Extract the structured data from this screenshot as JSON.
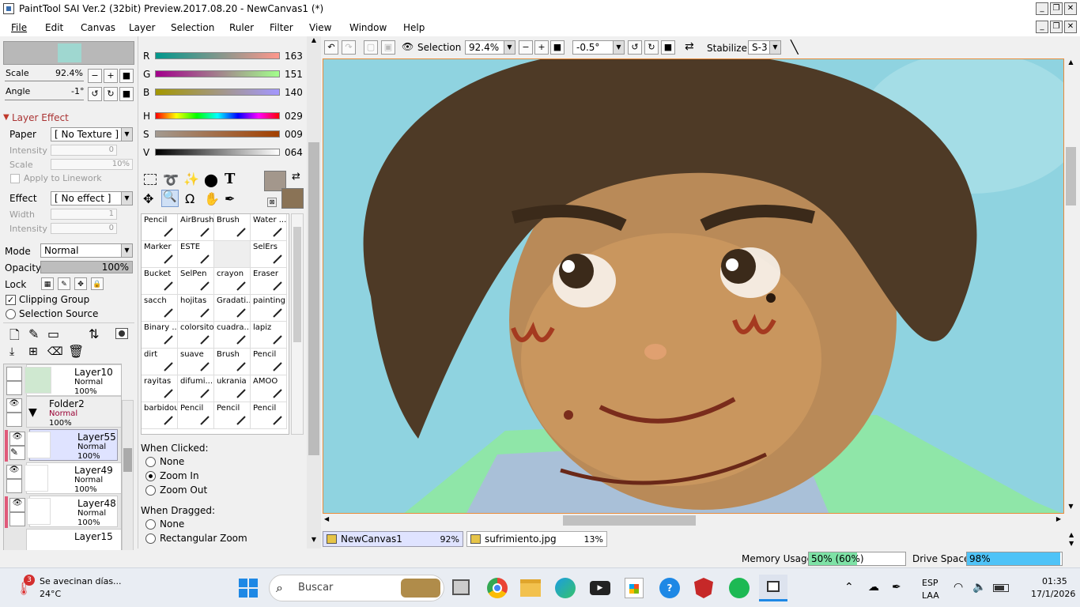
{
  "window": {
    "title": "PaintTool SAI Ver.2 (32bit) Preview.2017.08.20 - NewCanvas1 (*)"
  },
  "menu": [
    "File",
    "Edit",
    "Canvas",
    "Layer",
    "Selection",
    "Ruler",
    "Filter",
    "View",
    "Window",
    "Help"
  ],
  "nav": {
    "scale_label": "Scale",
    "scale_value": "92.4%",
    "angle_label": "Angle",
    "angle_value": "-1°"
  },
  "layer_effect": {
    "header": "Layer Effect",
    "paper_label": "Paper",
    "paper_value": "[ No Texture ]",
    "intensity_label": "Intensity",
    "intensity_value": "0",
    "scale_label": "Scale",
    "scale_value": "10%",
    "apply_linework": "Apply to Linework",
    "effect_label": "Effect",
    "effect_value": "[ No effect ]",
    "width_label": "Width",
    "width_value": "1",
    "intensity2_label": "Intensity",
    "intensity2_value": "0"
  },
  "layer_props": {
    "mode_label": "Mode",
    "mode_value": "Normal",
    "opacity_label": "Opacity",
    "opacity_value": "100%",
    "lock_label": "Lock",
    "clipping_group": "Clipping Group",
    "selection_source": "Selection Source"
  },
  "layers": [
    {
      "name": "Layer10",
      "mode": "Normal",
      "opacity": "100%"
    },
    {
      "name": "Folder2",
      "mode": "Normal",
      "opacity": "100%"
    },
    {
      "name": "Layer55",
      "mode": "Normal",
      "opacity": "100%"
    },
    {
      "name": "Layer49",
      "mode": "Normal",
      "opacity": "100%"
    },
    {
      "name": "Layer48",
      "mode": "Normal",
      "opacity": "100%"
    },
    {
      "name": "Layer15",
      "mode": "",
      "opacity": ""
    }
  ],
  "color": {
    "r_label": "R",
    "r_value": "163",
    "g_label": "G",
    "g_value": "151",
    "b_label": "B",
    "b_value": "140",
    "h_label": "H",
    "h_value": "029",
    "s_label": "S",
    "s_value": "009",
    "v_label": "V",
    "v_value": "064",
    "primary": "#a3978c",
    "secondary": "#8a7356"
  },
  "tools": [
    [
      "Pencil",
      "AirBrush",
      "Brush",
      "Water ..."
    ],
    [
      "Marker",
      "ESTE",
      "",
      "SelErs"
    ],
    [
      "Bucket",
      "SelPen",
      "crayon",
      "Eraser"
    ],
    [
      "sacch",
      "hojitas",
      "Gradati...",
      "painting"
    ],
    [
      "Binary ...",
      "colorsito",
      "cuadra...",
      "lapiz"
    ],
    [
      "dirt",
      "suave",
      "Brush",
      "Pencil"
    ],
    [
      "rayitas",
      "difumi...",
      "ukrania",
      "AMOO"
    ],
    [
      "barbidou",
      "Pencil",
      "Pencil",
      "Pencil"
    ]
  ],
  "zoom_options": {
    "when_clicked": "When Clicked:",
    "none": "None",
    "zoom_in": "Zoom In",
    "zoom_out": "Zoom Out",
    "when_dragged": "When Dragged:",
    "none2": "None",
    "rect_zoom": "Rectangular Zoom"
  },
  "toolbar": {
    "selection_label": "Selection",
    "zoom_value": "92.4%",
    "angle_value": "-0.5°",
    "stabilizer_label": "Stabilizer",
    "stabilizer_value": "S-3"
  },
  "tabs": [
    {
      "name": "NewCanvas1",
      "zoom": "92%"
    },
    {
      "name": "sufrimiento.jpg",
      "zoom": "13%"
    }
  ],
  "status": {
    "memory_label": "Memory Usage",
    "memory_value": "50% (60%)",
    "memory_fraction": 0.5,
    "drive_label": "Drive Space",
    "drive_value": "98%",
    "drive_fraction": 0.98
  },
  "taskbar": {
    "weather_text": "Se avecinan días...",
    "weather_temp": "24°C",
    "weather_badge": "3",
    "search_placeholder": "Buscar",
    "lang1": "ESP",
    "lang2": "LAA",
    "time": "01:35",
    "date": "17/1/2026"
  }
}
